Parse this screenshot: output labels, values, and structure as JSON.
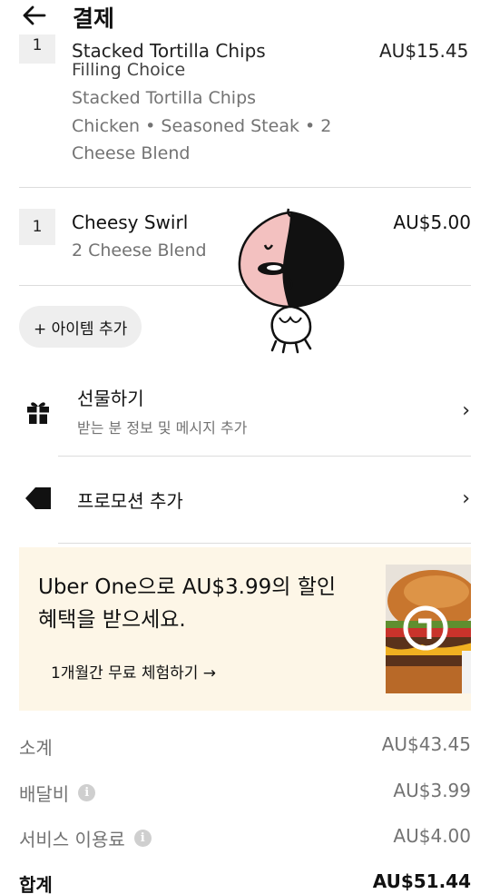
{
  "header": {
    "title": "결제",
    "back_icon": "arrow-left-icon"
  },
  "cart": {
    "items": [
      {
        "quantity": "1",
        "name": "Stacked Tortilla Chips",
        "price": "AU$15.45",
        "details": [
          "Filling Choice",
          "Stacked Tortilla Chips",
          "Chicken • Seasoned Steak • 2",
          "Cheese Blend"
        ]
      },
      {
        "quantity": "1",
        "name": "Cheesy Swirl",
        "price": "AU$5.00",
        "details": [
          "2 Cheese Blend"
        ]
      }
    ],
    "add_item_label": "+ 아이템 추가"
  },
  "gift": {
    "title": "선물하기",
    "subtitle": "받는 분 정보 및 메시지 추가",
    "icon": "gift-icon"
  },
  "promotion": {
    "title": "프로모션 추가",
    "icon": "tag-icon"
  },
  "uber_one": {
    "line1": "Uber One으로 AU$3.99의 할인",
    "line2": "혜택을 받으세요.",
    "cta": "1개월간 무료 체험하기 →"
  },
  "summary": {
    "subtotal_label": "소계",
    "subtotal_value": "AU$43.45",
    "delivery_label": "배달비",
    "delivery_value": "AU$3.99",
    "service_label": "서비스 이용료",
    "service_value": "AU$4.00",
    "total_label": "합계",
    "total_value": "AU$51.44",
    "info_icon_glyph": "i"
  },
  "colors": {
    "promo_background": "#fdf6e7",
    "divider": "#dcdcdc",
    "chip_background": "#eeeeee"
  }
}
